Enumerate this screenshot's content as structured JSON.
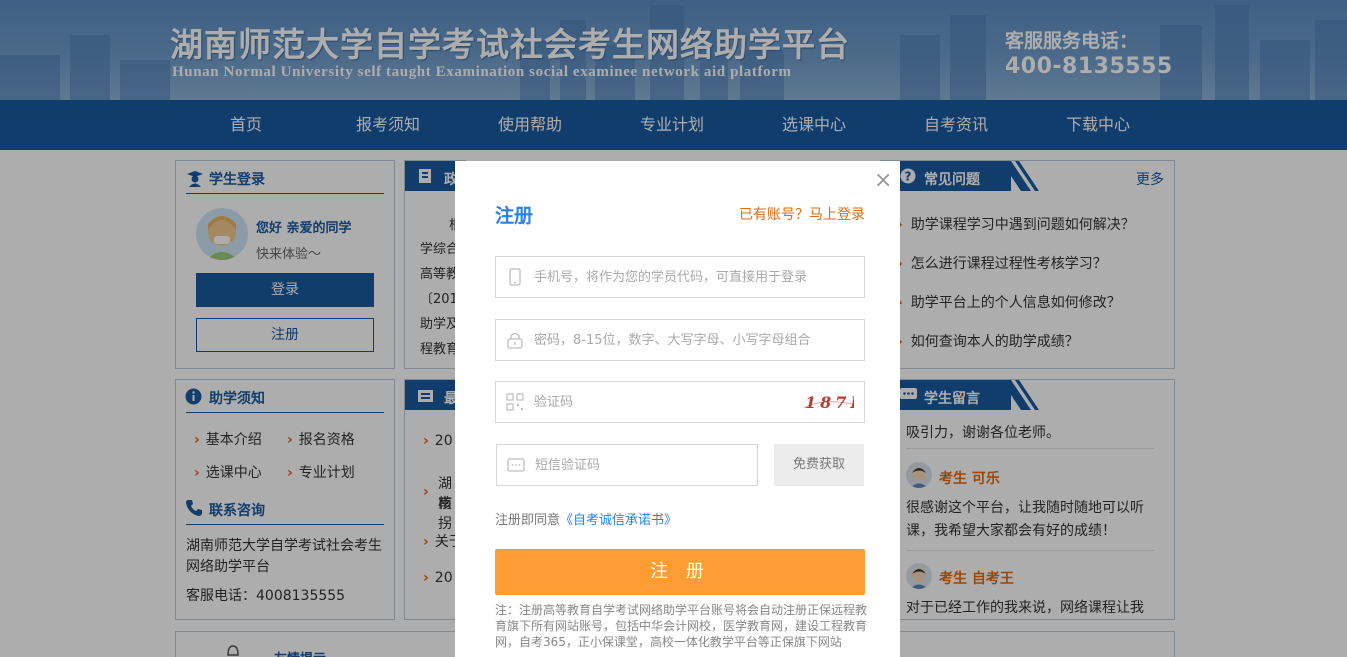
{
  "header": {
    "title": "湖南师范大学自学考试社会考生网络助学平台",
    "subtitle": "Hunan Normal University self taught Examination social examinee network aid platform",
    "hotline_label": "客服服务电话：",
    "hotline_number": "400-8135555"
  },
  "nav": {
    "items": [
      {
        "label": "首页"
      },
      {
        "label": "报考须知"
      },
      {
        "label": "使用帮助"
      },
      {
        "label": "专业计划"
      },
      {
        "label": "选课中心"
      },
      {
        "label": "自考资讯"
      },
      {
        "label": "下载中心"
      }
    ]
  },
  "login_box": {
    "title": "学生登录",
    "greeting": "您好 亲爱的同学",
    "sub_greeting": "快来体验～",
    "login_label": "登录",
    "register_label": "注册"
  },
  "policy_box": {
    "title_fragment": "政",
    "lines": [
      "根",
      "学综合",
      "高等教",
      "〔201",
      "助学及",
      "程教育"
    ]
  },
  "faq": {
    "title": "常见问题",
    "more": "更多",
    "items": [
      "助学课程学习中遇到问题如何解决？",
      "怎么进行课程过程性考核学习？",
      "助学平台上的个人信息如何修改？",
      "如何查询本人的助学成绩？"
    ]
  },
  "notice": {
    "title": "助学须知",
    "links": [
      "基本介绍",
      "报名资格",
      "选课中心",
      "专业计划"
    ],
    "contact_title": "联系咨询",
    "contact_org": "湖南师范大学自学考试社会考生网络助学平台",
    "contact_phone": "客服电话：4008135555"
  },
  "news_box": {
    "title_fragment": "最",
    "items": [
      "20",
      "湖南",
      "核拐",
      "关于",
      "20"
    ]
  },
  "messages": {
    "title": "学生留言",
    "first_tail": "吸引力，谢谢各位老师。",
    "entries": [
      {
        "author": "考生 可乐",
        "text": "很感谢这个平台，让我随时随地可以听课，我希望大家都会有好的成绩！"
      },
      {
        "author": "考生 自考王",
        "text": "对于已经工作的我来说，网络课程让我"
      }
    ]
  },
  "bottom_box": {
    "title": "友情提示"
  },
  "modal": {
    "title": "注册",
    "have_account": "已有账号？马上登录",
    "phone_placeholder": "手机号，将作为您的学员代码，可直接用于登录",
    "password_placeholder": "密码，8-15位，数字、大写字母、小写字母组合",
    "captcha_placeholder": "验证码",
    "captcha_text": "187F",
    "sms_placeholder": "短信验证码",
    "sms_button": "免费获取",
    "agree_prefix": "注册即同意",
    "agree_link": "《自考诚信承诺书》",
    "submit": "注 册",
    "note": "注：注册高等教育自学考试网络助学平台账号将会自动注册正保远程教育旗下所有网站账号，包括中华会计网校，医学教育网，建设工程教育网，自考365，正小保课堂，高校一体化教学平台等正保旗下网站",
    "close": "×"
  },
  "colors": {
    "primary": "#1a5aa1",
    "accent_orange": "#ff9d35",
    "link_blue": "#2a82e4",
    "link_orange": "#e36a0f"
  }
}
